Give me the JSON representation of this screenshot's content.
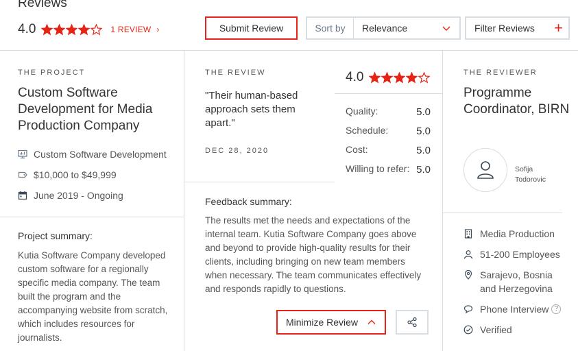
{
  "header": {
    "title": "Reviews",
    "overall_rating": "4.0",
    "overall_stars": 4,
    "review_link": "1 REVIEW",
    "submit_label": "Submit Review",
    "sort_label": "Sort by",
    "sort_value": "Relevance",
    "filter_label": "Filter Reviews"
  },
  "project": {
    "section_label": "THE PROJECT",
    "title": "Custom Software Development for Media Production Company",
    "service": "Custom Software Development",
    "budget": "$10,000 to $49,999",
    "dates": "June 2019 - Ongoing",
    "summary_label": "Project summary:",
    "summary": "Kutia Software Company developed custom software for a regionally specific media company. The team built the program and the accompanying website from scratch, which includes resources for journalists."
  },
  "review": {
    "section_label": "THE REVIEW",
    "quote": "\"Their human-based approach sets them apart.\"",
    "date": "DEC 28, 2020",
    "rating": "4.0",
    "stars": 4,
    "scores": [
      {
        "label": "Quality:",
        "value": "5.0"
      },
      {
        "label": "Schedule:",
        "value": "5.0"
      },
      {
        "label": "Cost:",
        "value": "5.0"
      },
      {
        "label": "Willing to refer:",
        "value": "5.0"
      }
    ],
    "feedback_label": "Feedback summary:",
    "feedback": "The results met the needs and expectations of the internal team. Kutia Software Company goes above and beyond to provide high-quality results for their clients, including bringing on new team members when necessary. The team communicates effectively and responds rapidly to questions.",
    "minimize_label": "Minimize Review"
  },
  "reviewer": {
    "section_label": "THE REVIEWER",
    "title": "Programme Coordinator, BIRN",
    "name_line1": "Sofija",
    "name_line2": "Todorovic",
    "industry": "Media Production",
    "size": "51-200 Employees",
    "location": "Sarajevo, Bosnia and Herzegovina",
    "interview": "Phone Interview",
    "help": "?",
    "status": "Verified"
  },
  "colors": {
    "accent": "#e62415",
    "border": "#d6dde3"
  }
}
